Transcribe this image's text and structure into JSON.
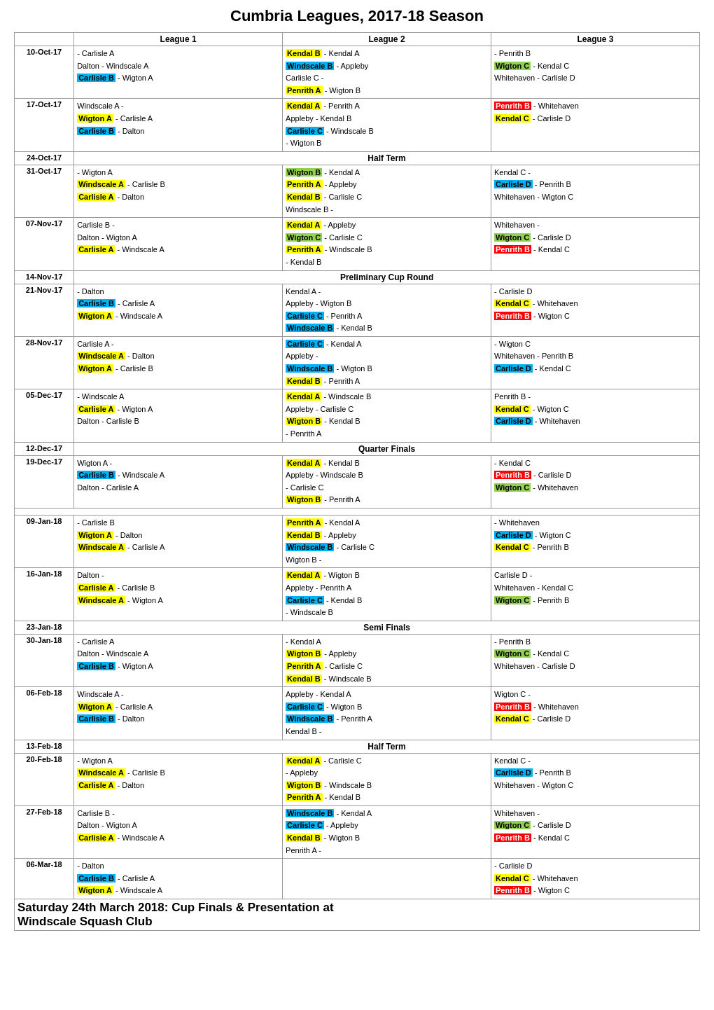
{
  "title": "Cumbria Leagues, 2017-18 Season",
  "footer": "Saturday 24th March 2018: Cup Finals & Presentation at Windscale Squash Club",
  "headers": [
    "League 1",
    "League 2",
    "League 3"
  ]
}
